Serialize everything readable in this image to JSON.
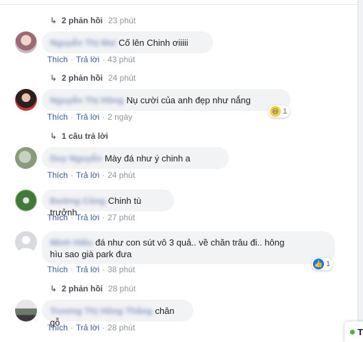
{
  "comments": [
    {
      "reply_count": "2 phản hồi",
      "reply_time": "23 phút"
    },
    {
      "name": "Nguyễn Thị Mai",
      "text": "Cố lên Chinh ơiiiii",
      "like": "Thích",
      "reply": "Trả lời",
      "time": "43 phút"
    },
    {
      "reply_count": "2 phản hồi",
      "reply_time": "24 phút"
    },
    {
      "name": "Nguyễn Thị Hồng",
      "text": "Nụ cười của anh đẹp như nắng",
      "like": "Thích",
      "reply": "Trả lời",
      "time": "2 ngày",
      "reaction_count": "1"
    },
    {
      "reply_count": "1 câu trả lời"
    },
    {
      "name": "Duy Nguyễn",
      "text": "Mày đá như  ý chinh  a",
      "like": "Thích",
      "reply": "Trả lời",
      "time": "24 phút"
    },
    {
      "name": "Đường Công",
      "text": "Chinh tù trưởnh",
      "like": "Thích",
      "reply": "Trả lời",
      "time": "27 phút"
    },
    {
      "name": "Minh Hiếu",
      "line1": "đá như con  sút  vô 3 quả.. về chăn trâu đi.. hông",
      "line2": "hìu sao già park đưa",
      "like": "Thích",
      "reply": "Trả lời",
      "time": "38 phút",
      "reaction_count": "1"
    },
    {
      "reply_count": "2 phản hồi",
      "reply_time": "28 phút"
    },
    {
      "name": "Trương Thị Hồng Thắng",
      "text": "chân gỗ",
      "like": "Thích",
      "reply": "Trả lời",
      "time": "28 phút"
    }
  ],
  "chat": {
    "label": "T"
  },
  "colors": {
    "link": "#385898",
    "bubble": "#f2f3f5",
    "like_blue": "#1877f2",
    "haha_yellow": "#f7d046"
  }
}
